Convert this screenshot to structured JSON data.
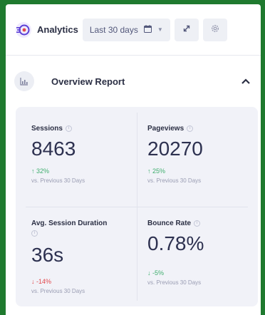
{
  "header": {
    "app_title": "Analytics",
    "date_range": "Last 30 days",
    "icons": [
      "analytics-logo-icon",
      "calendar-icon",
      "chevron-down-icon",
      "expand-icon",
      "settings-icon"
    ]
  },
  "section": {
    "title": "Overview Report",
    "icons": [
      "chart-icon",
      "chevron-up-icon"
    ]
  },
  "metrics": [
    {
      "label": "Sessions",
      "value": "8463",
      "change": "32%",
      "direction": "up",
      "compare": "vs. Previous 30 Days"
    },
    {
      "label": "Pageviews",
      "value": "20270",
      "change": "25%",
      "direction": "up",
      "compare": "vs. Previous 30 Days"
    },
    {
      "label": "Avg. Session Duration",
      "value": "36s",
      "change": "-14%",
      "direction": "down",
      "compare": "vs. Previous 30 Days"
    },
    {
      "label": "Bounce Rate",
      "value": "0.78%",
      "change": "-5%",
      "direction": "down",
      "compare": "vs. Previous 30 Days"
    }
  ],
  "colors": {
    "background": "#1f7a2f",
    "positive": "#3fae6e",
    "negative": "#e2474b",
    "accent": "#5b3fd6"
  }
}
